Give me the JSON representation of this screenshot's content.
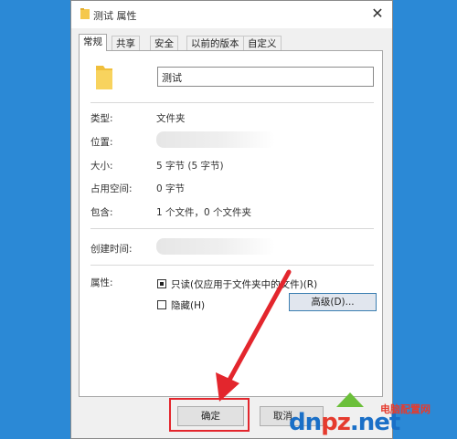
{
  "window": {
    "title": "测试 属性",
    "close_glyph": "✕"
  },
  "tabs": [
    {
      "label": "常规",
      "active": true
    },
    {
      "label": "共享",
      "active": false
    },
    {
      "label": "安全",
      "active": false
    },
    {
      "label": "以前的版本",
      "active": false
    },
    {
      "label": "自定义",
      "active": false
    }
  ],
  "general": {
    "name_value": "测试",
    "type_label": "类型:",
    "type_value": "文件夹",
    "location_label": "位置:",
    "size_label": "大小:",
    "size_value": "5 字节 (5 字节)",
    "size_on_disk_label": "占用空间:",
    "size_on_disk_value": "0 字节",
    "contains_label": "包含:",
    "contains_value": "1 个文件，0 个文件夹",
    "created_label": "创建时间:",
    "attributes_label": "属性:",
    "readonly_label": "只读(仅应用于文件夹中的文件)(R)",
    "readonly_state": "indeterminate",
    "hidden_label": "隐藏(H)",
    "hidden_checked": false,
    "advanced_button": "高级(D)..."
  },
  "footer": {
    "ok_button": "确定",
    "cancel_button": "取消"
  },
  "watermark": {
    "brand_prefix": "dn",
    "brand_mid": "pz",
    "brand_suffix": ".net",
    "chinese": "电脑配置网"
  },
  "colors": {
    "desktop": "#2b89d6",
    "annotation_red": "#e3262d",
    "folder_yellow": "#f5c84c",
    "button_focus": "#3c7fb1"
  },
  "icons": {
    "title_icon": "folder-icon",
    "big_icon": "folder-icon",
    "close": "close-icon"
  }
}
